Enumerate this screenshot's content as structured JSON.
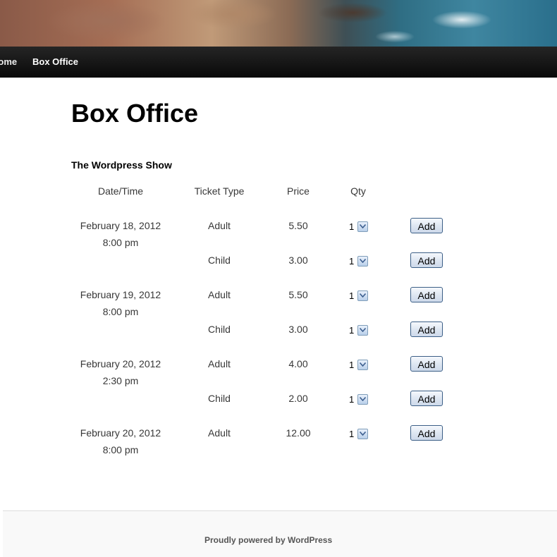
{
  "nav": {
    "home_label": "Home",
    "box_office_label": "Box Office"
  },
  "page": {
    "title": "Box Office",
    "show_title": "The Wordpress Show"
  },
  "table": {
    "headers": {
      "datetime": "Date/Time",
      "ticket_type": "Ticket Type",
      "price": "Price",
      "qty": "Qty"
    },
    "add_label": "Add",
    "performances": [
      {
        "date": "February 18, 2012",
        "time": "8:00 pm",
        "tickets": [
          {
            "type": "Adult",
            "price": "5.50",
            "qty": "1"
          },
          {
            "type": "Child",
            "price": "3.00",
            "qty": "1"
          }
        ]
      },
      {
        "date": "February 19, 2012",
        "time": "8:00 pm",
        "tickets": [
          {
            "type": "Adult",
            "price": "5.50",
            "qty": "1"
          },
          {
            "type": "Child",
            "price": "3.00",
            "qty": "1"
          }
        ]
      },
      {
        "date": "February 20, 2012",
        "time": "2:30 pm",
        "tickets": [
          {
            "type": "Adult",
            "price": "4.00",
            "qty": "1"
          },
          {
            "type": "Child",
            "price": "2.00",
            "qty": "1"
          }
        ]
      },
      {
        "date": "February 20, 2012",
        "time": "8:00 pm",
        "tickets": [
          {
            "type": "Adult",
            "price": "12.00",
            "qty": "1"
          }
        ]
      }
    ]
  },
  "footer": {
    "text": "Proudly powered by WordPress"
  }
}
